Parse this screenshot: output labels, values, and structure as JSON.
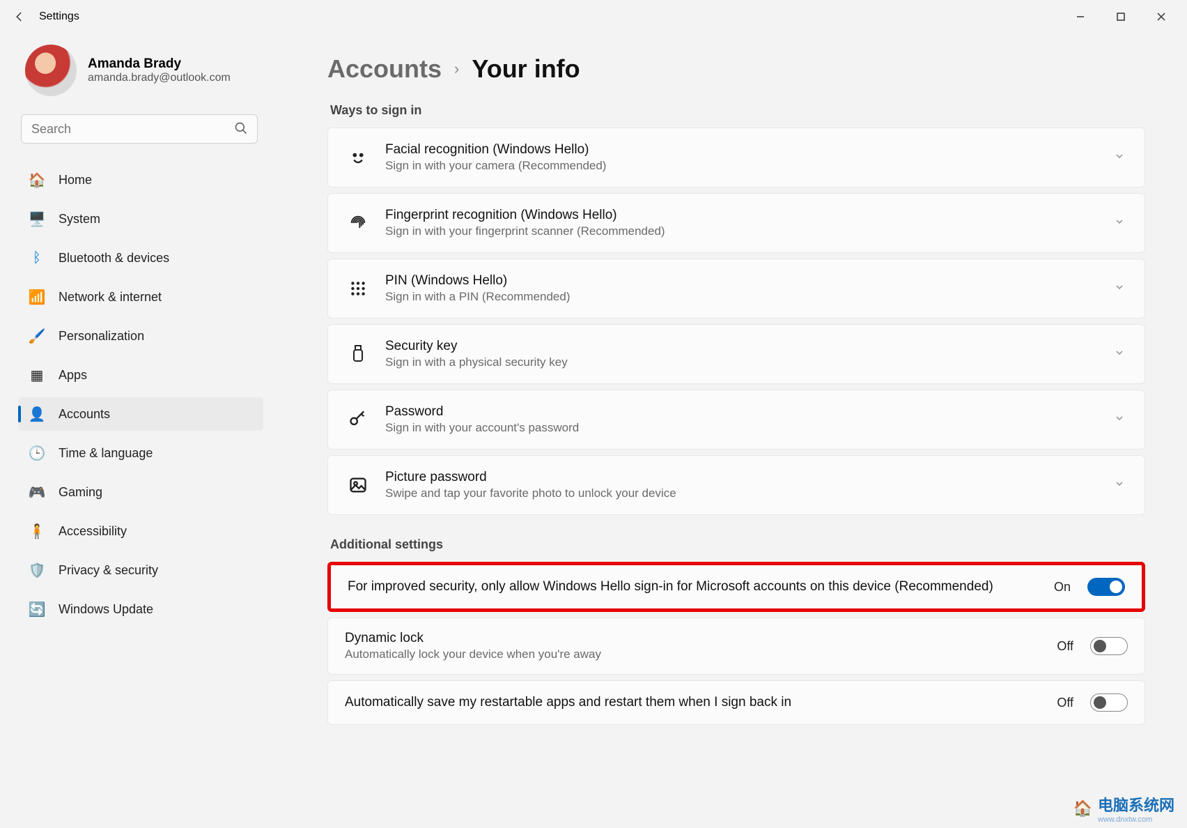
{
  "window": {
    "title": "Settings"
  },
  "user": {
    "name": "Amanda Brady",
    "email": "amanda.brady@outlook.com"
  },
  "search": {
    "placeholder": "Search"
  },
  "nav": [
    {
      "label": "Home"
    },
    {
      "label": "System"
    },
    {
      "label": "Bluetooth & devices"
    },
    {
      "label": "Network & internet"
    },
    {
      "label": "Personalization"
    },
    {
      "label": "Apps"
    },
    {
      "label": "Accounts"
    },
    {
      "label": "Time & language"
    },
    {
      "label": "Gaming"
    },
    {
      "label": "Accessibility"
    },
    {
      "label": "Privacy & security"
    },
    {
      "label": "Windows Update"
    }
  ],
  "breadcrumb": {
    "parent": "Accounts",
    "current": "Your info"
  },
  "sections": {
    "signin_header": "Ways to sign in",
    "additional_header": "Additional settings"
  },
  "signin": [
    {
      "title": "Facial recognition (Windows Hello)",
      "sub": "Sign in with your camera (Recommended)"
    },
    {
      "title": "Fingerprint recognition (Windows Hello)",
      "sub": "Sign in with your fingerprint scanner (Recommended)"
    },
    {
      "title": "PIN (Windows Hello)",
      "sub": "Sign in with a PIN (Recommended)"
    },
    {
      "title": "Security key",
      "sub": "Sign in with a physical security key"
    },
    {
      "title": "Password",
      "sub": "Sign in with your account's password"
    },
    {
      "title": "Picture password",
      "sub": "Swipe and tap your favorite photo to unlock your device"
    }
  ],
  "additional": [
    {
      "title": "For improved security, only allow Windows Hello sign-in for Microsoft accounts on this device (Recommended)",
      "state": "On",
      "on": true,
      "highlight": true
    },
    {
      "title": "Dynamic lock",
      "sub": "Automatically lock your device when you're away",
      "state": "Off",
      "on": false
    },
    {
      "title": "Automatically save my restartable apps and restart them when I sign back in",
      "state": "Off",
      "on": false
    }
  ],
  "watermark": {
    "text": "电脑系统网",
    "sub": "www.dnxtw.com"
  }
}
